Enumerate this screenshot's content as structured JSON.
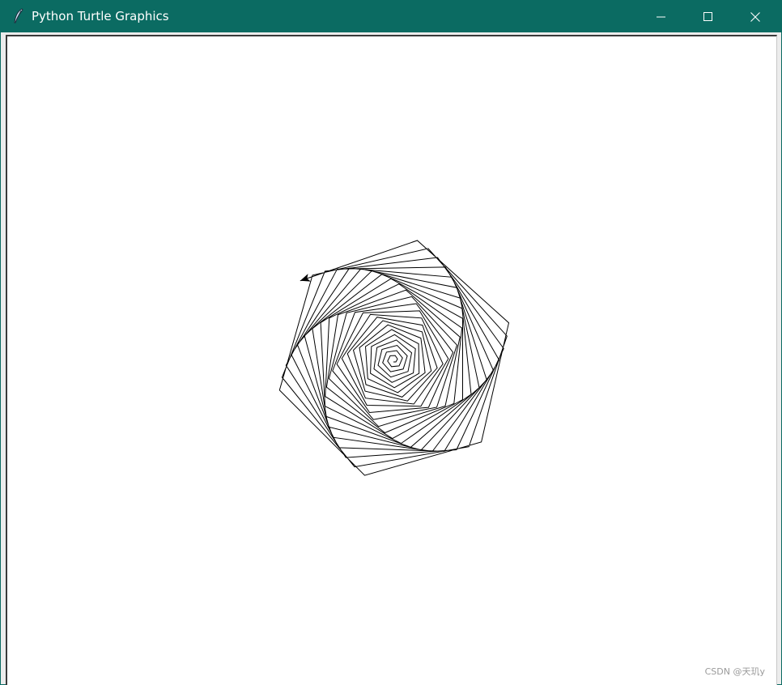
{
  "window": {
    "title": "Python Turtle Graphics",
    "icon": "feather-icon",
    "controls": {
      "minimize": "minimize-icon",
      "maximize": "maximize-icon",
      "close": "close-icon"
    },
    "titlebar_color": "#0b6b62"
  },
  "drawing": {
    "description_shape": "hexagon spiral",
    "sides": 6,
    "turtle_cursor": "arrow-turtle-icon",
    "line_color": "#000000",
    "background_color": "#ffffff"
  },
  "watermark": {
    "text": "CSDN @天玑y"
  }
}
